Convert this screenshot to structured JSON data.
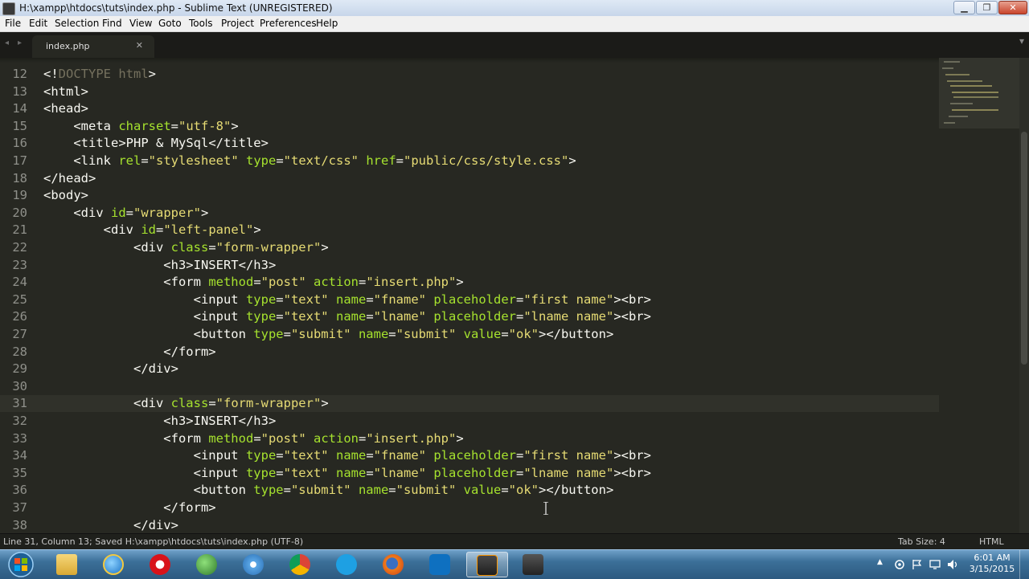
{
  "window": {
    "title": "H:\\xampp\\htdocs\\tuts\\index.php - Sublime Text (UNREGISTERED)",
    "controls": {
      "minimize": "▁",
      "maximize": "❐",
      "close": "✕"
    }
  },
  "menu": [
    "File",
    "Edit",
    "Selection",
    "Find",
    "View",
    "Goto",
    "Tools",
    "Project",
    "Preferences",
    "Help"
  ],
  "tabs": {
    "nav_left": "◂",
    "nav_right": "▸",
    "active": "index.php",
    "close": "✕",
    "dropdown": "▾"
  },
  "editor": {
    "current_line": 31,
    "lines": [
      {
        "n": "12",
        "code": [
          [
            "p",
            "<!"
          ],
          [
            "c",
            "DOCTYPE html"
          ],
          [
            "p",
            ">"
          ]
        ]
      },
      {
        "n": "13",
        "code": [
          [
            "p",
            "<html>"
          ]
        ]
      },
      {
        "n": "14",
        "code": [
          [
            "p",
            "<head>"
          ]
        ]
      },
      {
        "n": "15",
        "code": [
          [
            "p",
            "    <meta "
          ],
          [
            "a",
            "charset"
          ],
          [
            "p",
            "="
          ],
          [
            "s",
            "\"utf-8\""
          ],
          [
            "p",
            ">"
          ]
        ]
      },
      {
        "n": "16",
        "code": [
          [
            "p",
            "    <title>PHP "
          ],
          [
            "e",
            "&"
          ],
          [
            "p",
            " MySql</title>"
          ]
        ]
      },
      {
        "n": "17",
        "code": [
          [
            "p",
            "    <link "
          ],
          [
            "a",
            "rel"
          ],
          [
            "p",
            "="
          ],
          [
            "s",
            "\"stylesheet\""
          ],
          [
            "p",
            " "
          ],
          [
            "a",
            "type"
          ],
          [
            "p",
            "="
          ],
          [
            "s",
            "\"text/css\""
          ],
          [
            "p",
            " "
          ],
          [
            "a",
            "href"
          ],
          [
            "p",
            "="
          ],
          [
            "s",
            "\"public/css/style.css\""
          ],
          [
            "p",
            ">"
          ]
        ]
      },
      {
        "n": "18",
        "code": [
          [
            "p",
            "</head>"
          ]
        ]
      },
      {
        "n": "19",
        "code": [
          [
            "p",
            "<body>"
          ]
        ]
      },
      {
        "n": "20",
        "code": [
          [
            "p",
            "    <div "
          ],
          [
            "a",
            "id"
          ],
          [
            "p",
            "="
          ],
          [
            "s",
            "\"wrapper\""
          ],
          [
            "p",
            ">"
          ]
        ]
      },
      {
        "n": "21",
        "code": [
          [
            "p",
            "        <div "
          ],
          [
            "a",
            "id"
          ],
          [
            "p",
            "="
          ],
          [
            "s",
            "\"left-panel\""
          ],
          [
            "p",
            ">"
          ]
        ]
      },
      {
        "n": "22",
        "code": [
          [
            "p",
            "            <div "
          ],
          [
            "a",
            "class"
          ],
          [
            "p",
            "="
          ],
          [
            "s",
            "\"form-wrapper\""
          ],
          [
            "p",
            ">"
          ]
        ]
      },
      {
        "n": "23",
        "code": [
          [
            "p",
            "                <h3>INSERT</h3>"
          ]
        ]
      },
      {
        "n": "24",
        "code": [
          [
            "p",
            "                <form "
          ],
          [
            "a",
            "method"
          ],
          [
            "p",
            "="
          ],
          [
            "s",
            "\"post\""
          ],
          [
            "p",
            " "
          ],
          [
            "a",
            "action"
          ],
          [
            "p",
            "="
          ],
          [
            "s",
            "\"insert.php\""
          ],
          [
            "p",
            ">"
          ]
        ]
      },
      {
        "n": "25",
        "code": [
          [
            "p",
            "                    <input "
          ],
          [
            "a",
            "type"
          ],
          [
            "p",
            "="
          ],
          [
            "s",
            "\"text\""
          ],
          [
            "p",
            " "
          ],
          [
            "a",
            "name"
          ],
          [
            "p",
            "="
          ],
          [
            "s",
            "\"fname\""
          ],
          [
            "p",
            " "
          ],
          [
            "a",
            "placeholder"
          ],
          [
            "p",
            "="
          ],
          [
            "s",
            "\"first name\""
          ],
          [
            "p",
            "><br>"
          ]
        ]
      },
      {
        "n": "26",
        "code": [
          [
            "p",
            "                    <input "
          ],
          [
            "a",
            "type"
          ],
          [
            "p",
            "="
          ],
          [
            "s",
            "\"text\""
          ],
          [
            "p",
            " "
          ],
          [
            "a",
            "name"
          ],
          [
            "p",
            "="
          ],
          [
            "s",
            "\"lname\""
          ],
          [
            "p",
            " "
          ],
          [
            "a",
            "placeholder"
          ],
          [
            "p",
            "="
          ],
          [
            "s",
            "\"lname name\""
          ],
          [
            "p",
            "><br>"
          ]
        ]
      },
      {
        "n": "27",
        "code": [
          [
            "p",
            "                    <button "
          ],
          [
            "a",
            "type"
          ],
          [
            "p",
            "="
          ],
          [
            "s",
            "\"submit\""
          ],
          [
            "p",
            " "
          ],
          [
            "a",
            "name"
          ],
          [
            "p",
            "="
          ],
          [
            "s",
            "\"submit\""
          ],
          [
            "p",
            " "
          ],
          [
            "a",
            "value"
          ],
          [
            "p",
            "="
          ],
          [
            "s",
            "\"ok\""
          ],
          [
            "p",
            "></button>"
          ]
        ]
      },
      {
        "n": "28",
        "code": [
          [
            "p",
            "                </form>"
          ]
        ]
      },
      {
        "n": "29",
        "code": [
          [
            "p",
            "            </div>"
          ]
        ]
      },
      {
        "n": "30",
        "code": []
      },
      {
        "n": "31",
        "code": [
          [
            "p",
            "            <div "
          ],
          [
            "a",
            "class"
          ],
          [
            "p",
            "="
          ],
          [
            "s",
            "\"form-wrapper\""
          ],
          [
            "p",
            ">"
          ]
        ]
      },
      {
        "n": "32",
        "code": [
          [
            "p",
            "                <h3>INSERT</h3>"
          ]
        ]
      },
      {
        "n": "33",
        "code": [
          [
            "p",
            "                <form "
          ],
          [
            "a",
            "method"
          ],
          [
            "p",
            "="
          ],
          [
            "s",
            "\"post\""
          ],
          [
            "p",
            " "
          ],
          [
            "a",
            "action"
          ],
          [
            "p",
            "="
          ],
          [
            "s",
            "\"insert.php\""
          ],
          [
            "p",
            ">"
          ]
        ]
      },
      {
        "n": "34",
        "code": [
          [
            "p",
            "                    <input "
          ],
          [
            "a",
            "type"
          ],
          [
            "p",
            "="
          ],
          [
            "s",
            "\"text\""
          ],
          [
            "p",
            " "
          ],
          [
            "a",
            "name"
          ],
          [
            "p",
            "="
          ],
          [
            "s",
            "\"fname\""
          ],
          [
            "p",
            " "
          ],
          [
            "a",
            "placeholder"
          ],
          [
            "p",
            "="
          ],
          [
            "s",
            "\"first name\""
          ],
          [
            "p",
            "><br>"
          ]
        ]
      },
      {
        "n": "35",
        "code": [
          [
            "p",
            "                    <input "
          ],
          [
            "a",
            "type"
          ],
          [
            "p",
            "="
          ],
          [
            "s",
            "\"text\""
          ],
          [
            "p",
            " "
          ],
          [
            "a",
            "name"
          ],
          [
            "p",
            "="
          ],
          [
            "s",
            "\"lname\""
          ],
          [
            "p",
            " "
          ],
          [
            "a",
            "placeholder"
          ],
          [
            "p",
            "="
          ],
          [
            "s",
            "\"lname name\""
          ],
          [
            "p",
            "><br>"
          ]
        ]
      },
      {
        "n": "36",
        "code": [
          [
            "p",
            "                    <button "
          ],
          [
            "a",
            "type"
          ],
          [
            "p",
            "="
          ],
          [
            "s",
            "\"submit\""
          ],
          [
            "p",
            " "
          ],
          [
            "a",
            "name"
          ],
          [
            "p",
            "="
          ],
          [
            "s",
            "\"submit\""
          ],
          [
            "p",
            " "
          ],
          [
            "a",
            "value"
          ],
          [
            "p",
            "="
          ],
          [
            "s",
            "\"ok\""
          ],
          [
            "p",
            "></button>"
          ]
        ]
      },
      {
        "n": "37",
        "code": [
          [
            "p",
            "                </form>"
          ]
        ]
      },
      {
        "n": "38",
        "code": [
          [
            "p",
            "            </div>"
          ]
        ]
      }
    ]
  },
  "status": {
    "left": "Line 31, Column 13; Saved H:\\xampp\\htdocs\\tuts\\index.php (UTF-8)",
    "tab_size": "Tab Size: 4",
    "syntax": "HTML"
  },
  "taskbar": {
    "apps": [
      "start-orb",
      "file-explorer",
      "internet-explorer",
      "opera",
      "network-globe",
      "safari",
      "chrome",
      "skype",
      "firefox",
      "teamviewer",
      "sublime-text",
      "xampp"
    ],
    "active_app": "sublime-text",
    "tray": {
      "show_hidden": "▲",
      "clock_time": "6:01 AM",
      "clock_date": "3/15/2015"
    }
  },
  "colors": {
    "editor_bg": "#272822",
    "tag_text": "#f8f8f2",
    "attribute": "#a6e22e",
    "string": "#e6db74",
    "comment_gray": "#75715e",
    "gutter_text": "#8f908a"
  }
}
